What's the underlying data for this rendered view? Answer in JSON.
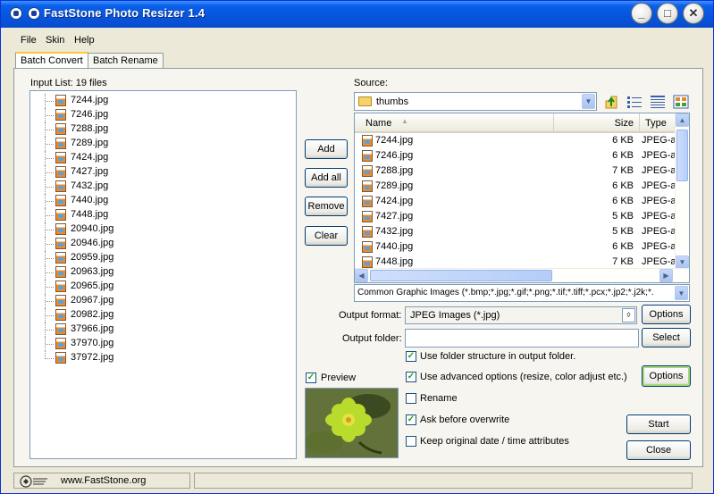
{
  "app": {
    "title": "FastStone Photo Resizer 1.4"
  },
  "menu": {
    "file": "File",
    "skin": "Skin",
    "help": "Help"
  },
  "tabs": {
    "batch_convert": "Batch Convert",
    "batch_rename": "Batch Rename"
  },
  "input_list": {
    "label": "Input List:  19 files",
    "files": [
      "7244.jpg",
      "7246.jpg",
      "7288.jpg",
      "7289.jpg",
      "7424.jpg",
      "7427.jpg",
      "7432.jpg",
      "7440.jpg",
      "7448.jpg",
      "20940.jpg",
      "20946.jpg",
      "20959.jpg",
      "20963.jpg",
      "20965.jpg",
      "20967.jpg",
      "20982.jpg",
      "37966.jpg",
      "37970.jpg",
      "37972.jpg"
    ]
  },
  "actions": {
    "add": "Add",
    "add_all": "Add all",
    "remove": "Remove",
    "clear": "Clear"
  },
  "source": {
    "label": "Source:",
    "folder": "thumbs",
    "columns": {
      "name": "Name",
      "size": "Size",
      "type": "Type"
    },
    "files": [
      {
        "name": "7244.jpg",
        "size": "6 KB",
        "type": "JPEG-a"
      },
      {
        "name": "7246.jpg",
        "size": "6 KB",
        "type": "JPEG-a"
      },
      {
        "name": "7288.jpg",
        "size": "7 KB",
        "type": "JPEG-a"
      },
      {
        "name": "7289.jpg",
        "size": "6 KB",
        "type": "JPEG-a"
      },
      {
        "name": "7424.jpg",
        "size": "6 KB",
        "type": "JPEG-a"
      },
      {
        "name": "7427.jpg",
        "size": "5 KB",
        "type": "JPEG-a"
      },
      {
        "name": "7432.jpg",
        "size": "5 KB",
        "type": "JPEG-a"
      },
      {
        "name": "7440.jpg",
        "size": "6 KB",
        "type": "JPEG-a"
      },
      {
        "name": "7448.jpg",
        "size": "7 KB",
        "type": "JPEG-a"
      }
    ],
    "filter": "Common Graphic Images (*.bmp;*.jpg;*.gif;*.png;*.tif;*.tiff;*.pcx;*.jp2;*.j2k;*."
  },
  "output": {
    "format_label": "Output format:",
    "format_value": "JPEG Images (*.jpg)",
    "options": "Options",
    "folder_label": "Output folder:",
    "folder_value": "",
    "select": "Select"
  },
  "checks": {
    "folder_structure": "Use folder structure in output folder.",
    "advanced": "Use advanced options (resize, color adjust etc.)",
    "rename": "Rename",
    "ask_overwrite": "Ask before overwrite",
    "keep_date": "Keep original date / time attributes"
  },
  "advanced_options": "Options",
  "preview": "Preview",
  "start": "Start",
  "close": "Close",
  "status": {
    "url": "www.FastStone.org"
  },
  "colors": {
    "title_blue": "#0754dc",
    "accent_green": "#21a121"
  }
}
